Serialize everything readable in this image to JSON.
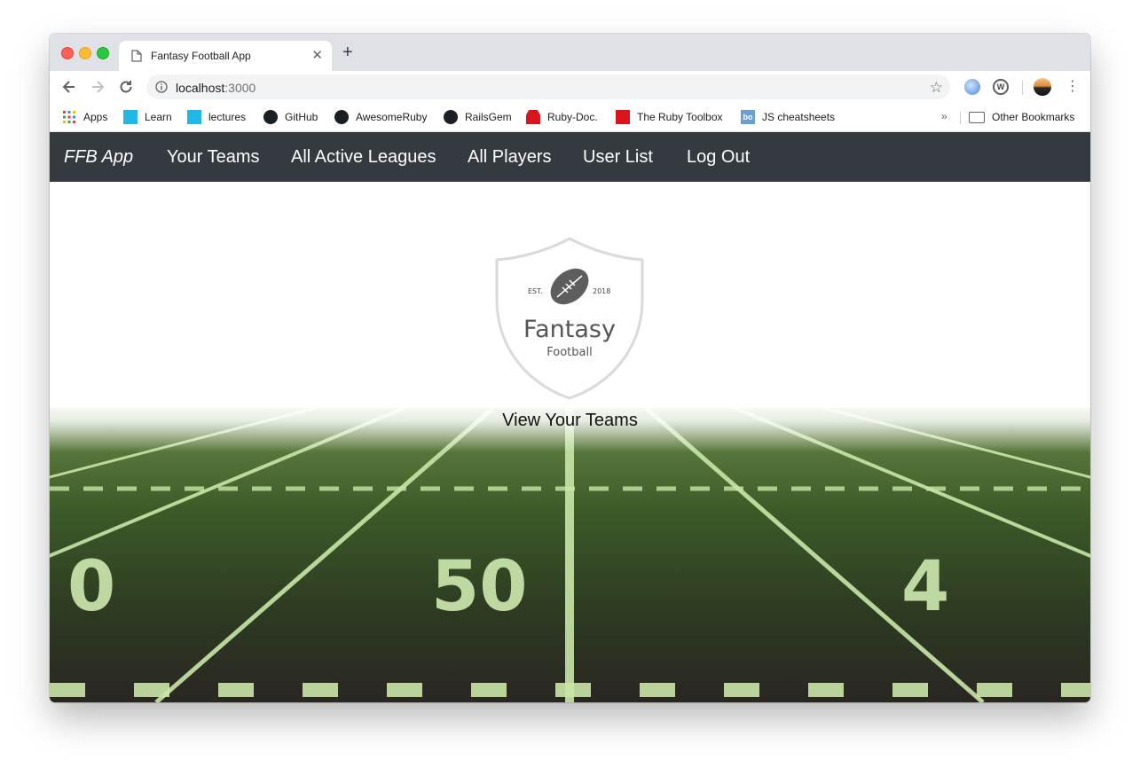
{
  "browser": {
    "tab_title": "Fantasy Football App",
    "url_host": "localhost",
    "url_port": ":3000",
    "bookmarks": [
      {
        "label": "Apps",
        "icon": "apps-grid-icon"
      },
      {
        "label": "Learn",
        "icon": "learn-icon"
      },
      {
        "label": "lectures",
        "icon": "lectures-icon"
      },
      {
        "label": "GitHub",
        "icon": "github-icon"
      },
      {
        "label": "AwesomeRuby",
        "icon": "github-icon"
      },
      {
        "label": "RailsGem",
        "icon": "github-icon"
      },
      {
        "label": "Ruby-Doc.",
        "icon": "ruby-icon"
      },
      {
        "label": "The Ruby Toolbox",
        "icon": "gift-icon"
      },
      {
        "label": "JS cheatsheets",
        "icon": "bo-icon"
      }
    ],
    "overflow_label": "»",
    "other_bookmarks": "Other Bookmarks"
  },
  "nav": {
    "brand": "FFB App",
    "items": [
      "Your Teams",
      "All Active Leagues",
      "All Players",
      "User List",
      "Log Out"
    ]
  },
  "logo": {
    "est": "EST.",
    "year": "2018",
    "line1": "Fantasy",
    "line2": "Football"
  },
  "main": {
    "cta": "View Your Teams"
  },
  "field": {
    "numbers": [
      "0",
      "50",
      "4"
    ]
  },
  "colors": {
    "navbar": "#343a40",
    "tab_strip": "#dee1e6"
  }
}
